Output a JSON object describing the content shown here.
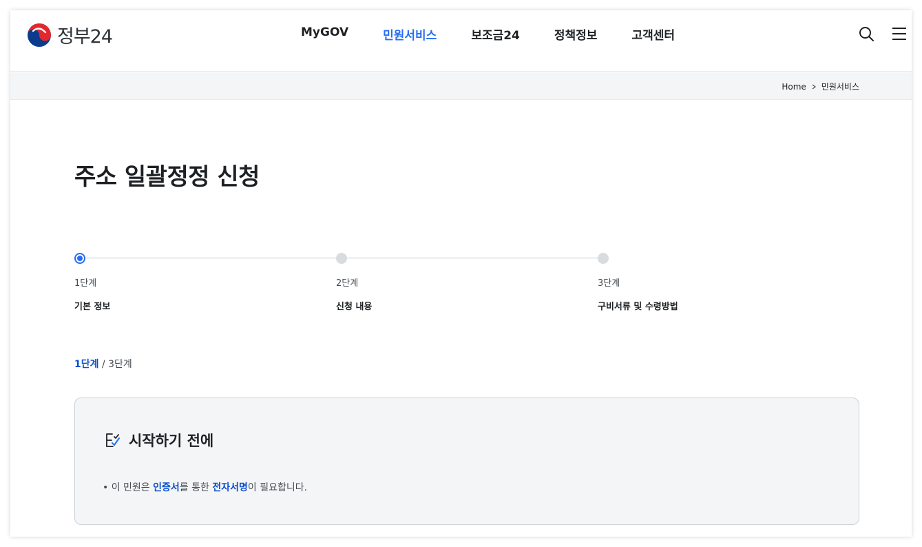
{
  "header": {
    "logo_text": "정부24",
    "nav": [
      "MyGOV",
      "민원서비스",
      "보조금24",
      "정책정보",
      "고객센터"
    ],
    "active_index": 1,
    "search_icon": "search-icon",
    "menu_icon": "hamburger-menu-icon"
  },
  "breadcrumb": {
    "home": "Home",
    "current": "민원서비스"
  },
  "page": {
    "title": "주소 일괄정정 신청"
  },
  "stepper": {
    "steps": [
      {
        "num": "1단계",
        "name": "기본 정보",
        "state": "current"
      },
      {
        "num": "2단계",
        "name": "신청 내용",
        "state": "upcoming"
      },
      {
        "num": "3단계",
        "name": "구비서류 및 수령방법",
        "state": "upcoming"
      }
    ]
  },
  "step_count": {
    "current": "1단계",
    "separator": " / ",
    "total": "3단계"
  },
  "notice": {
    "icon": "checklist-icon",
    "title": "시작하기 전에",
    "bullet": "•",
    "text_parts": [
      "이 민원은 ",
      "인증서",
      "를 통한 ",
      "전자서명",
      "이 필요합니다."
    ]
  },
  "colors": {
    "accent": "#256ef4",
    "emphasis": "#0b50d0",
    "text": "#1e2124"
  }
}
